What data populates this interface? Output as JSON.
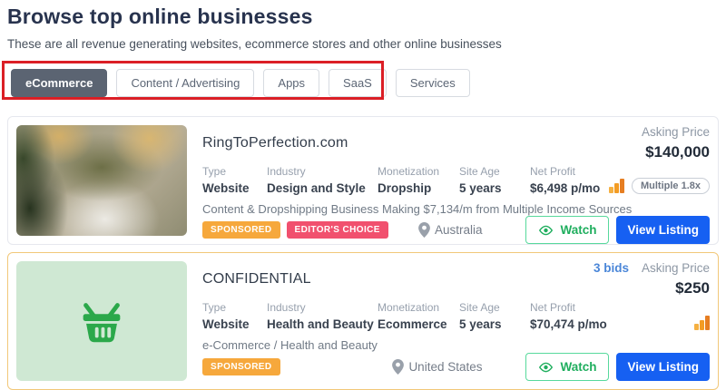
{
  "page": {
    "title": "Browse top online businesses",
    "subtitle": "These are all revenue generating websites, ecommerce stores and other online businesses"
  },
  "tabs": [
    {
      "label": "eCommerce",
      "active": true
    },
    {
      "label": "Content / Advertising",
      "active": false
    },
    {
      "label": "Apps",
      "active": false
    },
    {
      "label": "SaaS",
      "active": false
    },
    {
      "label": "Services",
      "active": false
    }
  ],
  "listings": [
    {
      "title": "RingToPerfection.com",
      "price": {
        "label": "Asking Price",
        "value": "$140,000"
      },
      "fields": [
        {
          "label": "Type",
          "value": "Website"
        },
        {
          "label": "Industry",
          "value": "Design and Style"
        },
        {
          "label": "Monetization",
          "value": "Dropship"
        },
        {
          "label": "Site Age",
          "value": "5 years"
        },
        {
          "label": "Net Profit",
          "value": "$6,498 p/mo"
        }
      ],
      "multiple": "Multiple 1.8x",
      "description": "Content & Dropshipping Business Making $7,134/m from Multiple Income Sources",
      "badges": [
        "SPONSORED",
        "EDITOR'S CHOICE"
      ],
      "location": "Australia",
      "watch": "Watch",
      "view": "View Listing"
    },
    {
      "title": "CONFIDENTIAL",
      "bids": "3 bids",
      "price": {
        "label": "Asking Price",
        "value": "$250"
      },
      "fields": [
        {
          "label": "Type",
          "value": "Website"
        },
        {
          "label": "Industry",
          "value": "Health and Beauty"
        },
        {
          "label": "Monetization",
          "value": "Ecommerce"
        },
        {
          "label": "Site Age",
          "value": "5 years"
        },
        {
          "label": "Net Profit",
          "value": "$70,474 p/mo"
        }
      ],
      "description": "e-Commerce / Health and Beauty",
      "badges": [
        "SPONSORED"
      ],
      "location": "United States",
      "watch": "Watch",
      "view": "View Listing"
    }
  ],
  "icons": {
    "watch": "eye-icon",
    "location": "map-pin-icon",
    "revenue": "bar-chart-icon",
    "confidential_thumb": "shopping-basket-icon"
  },
  "colors": {
    "annotation_red": "#db1f26",
    "active_tab_bg": "#5b6472",
    "sponsored_badge": "#f6a83c",
    "editors_choice_badge": "#f1506e",
    "watch_green": "#1fae5e",
    "view_listing_blue": "#1660f2",
    "basket_green": "#2ba84a",
    "bids_blue": "#4a86d8",
    "featured_card_border": "#f2c879"
  }
}
